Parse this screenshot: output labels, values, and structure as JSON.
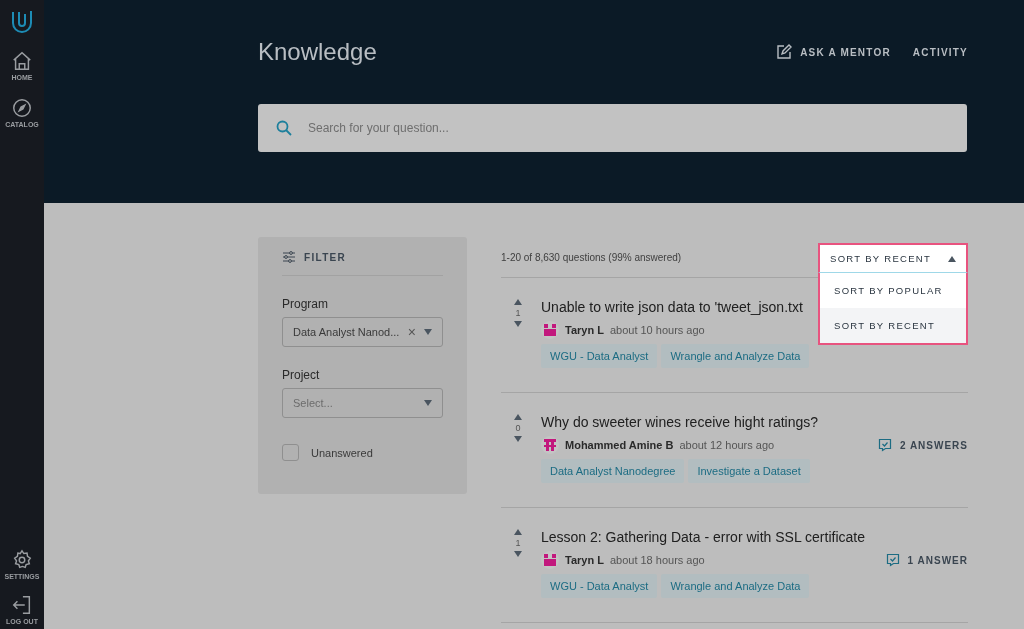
{
  "sidebar": {
    "top_items": [
      {
        "kind": "home",
        "label": "HOME"
      },
      {
        "kind": "catalog",
        "label": "CATALOG"
      }
    ],
    "bottom_items": [
      {
        "kind": "settings",
        "label": "SETTINGS"
      },
      {
        "kind": "logout",
        "label": "LOG OUT"
      }
    ]
  },
  "header": {
    "title": "Knowledge",
    "links": [
      {
        "kind": "edit",
        "label": "ASK A MENTOR"
      },
      {
        "kind": "plain",
        "label": "ACTIVITY"
      }
    ],
    "search": {
      "placeholder": "Search for your question..."
    }
  },
  "filter": {
    "title": "FILTER",
    "program": {
      "label": "Program",
      "value": "Data Analyst Nanod...",
      "clear": "×"
    },
    "project": {
      "label": "Project",
      "placeholder": "Select..."
    },
    "unanswered": {
      "label": "Unanswered",
      "checked": false
    }
  },
  "results": {
    "summary": "1-20 of 8,630 questions (99% answered)",
    "sort": {
      "label": "SORT BY RECENT",
      "expanded": true,
      "options": [
        {
          "label": "SORT BY POPULAR",
          "selected": false
        },
        {
          "label": "SORT BY RECENT",
          "selected": true
        }
      ]
    },
    "questions": [
      {
        "votes": "1",
        "title": "Unable to write json data to 'tweet_json.txt",
        "author": "Taryn L",
        "time": "about 10 hours ago",
        "avatar": {
          "kind": "blocks"
        },
        "tags": [
          "WGU - Data Analyst",
          "Wrangle and Analyze Data"
        ]
      },
      {
        "votes": "0",
        "title": "Why do sweeter wines receive hight ratings?",
        "author": "Mohammed Amine B",
        "time": "about 12 hours ago",
        "avatar": {
          "kind": "pillars"
        },
        "answers": "2 ANSWERS",
        "tags": [
          "Data Analyst Nanodegree",
          "Investigate a Dataset"
        ]
      },
      {
        "votes": "1",
        "title": "Lesson 2: Gathering Data - error with SSL certificate",
        "author": "Taryn L",
        "time": "about 18 hours ago",
        "avatar": {
          "kind": "blocks"
        },
        "answers": "1 ANSWER",
        "tags": [
          "WGU - Data Analyst",
          "Wrangle and Analyze Data"
        ]
      }
    ]
  }
}
